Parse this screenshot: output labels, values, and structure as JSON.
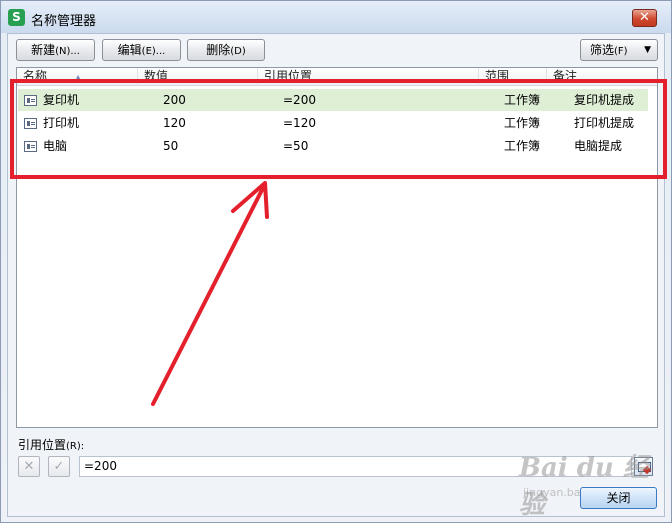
{
  "window": {
    "title": "名称管理器",
    "app_icon_letter": "S"
  },
  "toolbar": {
    "new_label": "新建",
    "new_shortcut": "(N)...",
    "edit_label": "编辑",
    "edit_shortcut": "(E)...",
    "delete_label": "删除",
    "delete_shortcut": "(D)",
    "filter_label": "筛选",
    "filter_shortcut": "(F)"
  },
  "columns": [
    "名称",
    "数值",
    "引用位置",
    "范围",
    "备注"
  ],
  "rows": [
    {
      "name": "复印机",
      "value": "200",
      "ref": "=200",
      "scope": "工作簿",
      "comment": "复印机提成",
      "selected": true
    },
    {
      "name": "打印机",
      "value": "120",
      "ref": "=120",
      "scope": "工作簿",
      "comment": "打印机提成",
      "selected": false
    },
    {
      "name": "电脑",
      "value": "50",
      "ref": "=50",
      "scope": "工作簿",
      "comment": "电脑提成",
      "selected": false
    }
  ],
  "reference": {
    "label": "引用位置",
    "shortcut": "(R):",
    "value": "=200",
    "cancel_glyph": "✕",
    "confirm_glyph": "✓"
  },
  "footer": {
    "close_label": "关闭"
  },
  "watermark": {
    "main": "Bai du 经验",
    "sub": "jingyan.baidu.com"
  },
  "colors": {
    "selection": "#deefd6",
    "annotation_red": "#e4202c",
    "app_green": "#27a151"
  }
}
